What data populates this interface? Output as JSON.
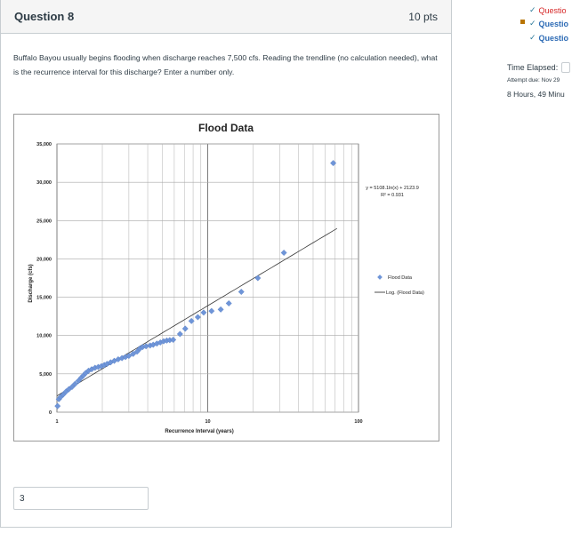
{
  "question": {
    "title": "Question 8",
    "points": "10 pts",
    "text": "Buffalo Bayou usually begins flooding when discharge reaches 7,500 cfs. Reading the trendline (no calculation needed), what is the recurrence interval for this discharge? Enter a number only.",
    "answer_value": "3"
  },
  "sidebar": {
    "items": [
      {
        "label": "Questio",
        "color": "#d62828",
        "status": "answered"
      },
      {
        "label": "Questio",
        "color": "#2d6bb5",
        "status": "flagged"
      },
      {
        "label": "Questio",
        "color": "#2d6bb5",
        "status": "answered"
      }
    ],
    "time_elapsed_label": "Time Elapsed:",
    "attempt_due": "Attempt due: Nov 29",
    "elapsed_value": "8 Hours, 49 Minu"
  },
  "chart_data": {
    "type": "scatter",
    "title": "Flood Data",
    "xlabel": "Recurrence Interval (years)",
    "ylabel": "Discharge (cfs)",
    "x_scale": "log",
    "xlim": [
      1,
      100
    ],
    "ylim": [
      0,
      35000
    ],
    "x_ticks": [
      "1",
      "10",
      "100"
    ],
    "y_ticks": [
      "0",
      "5,000",
      "10,000",
      "15,000",
      "20,000",
      "25,000",
      "30,000",
      "35,000"
    ],
    "grid": true,
    "legend_position": "right",
    "series": [
      {
        "name": "Flood Data",
        "color": "#6f95d8",
        "points": [
          [
            1.01,
            800
          ],
          [
            1.03,
            1700
          ],
          [
            1.06,
            2000
          ],
          [
            1.1,
            2300
          ],
          [
            1.15,
            2700
          ],
          [
            1.2,
            3000
          ],
          [
            1.26,
            3300
          ],
          [
            1.32,
            3700
          ],
          [
            1.39,
            4100
          ],
          [
            1.45,
            4500
          ],
          [
            1.5,
            4800
          ],
          [
            1.55,
            5100
          ],
          [
            1.62,
            5400
          ],
          [
            1.7,
            5600
          ],
          [
            1.79,
            5800
          ],
          [
            1.88,
            5900
          ],
          [
            1.97,
            6000
          ],
          [
            2.06,
            6150
          ],
          [
            2.15,
            6300
          ],
          [
            2.27,
            6500
          ],
          [
            2.4,
            6700
          ],
          [
            2.55,
            6900
          ],
          [
            2.7,
            7050
          ],
          [
            2.85,
            7200
          ],
          [
            3.0,
            7350
          ],
          [
            3.2,
            7600
          ],
          [
            3.4,
            7900
          ],
          [
            3.55,
            8300
          ],
          [
            3.7,
            8500
          ],
          [
            3.9,
            8600
          ],
          [
            4.15,
            8700
          ],
          [
            4.35,
            8800
          ],
          [
            4.6,
            8950
          ],
          [
            4.85,
            9100
          ],
          [
            5.1,
            9250
          ],
          [
            5.35,
            9350
          ],
          [
            5.6,
            9400
          ],
          [
            5.9,
            9450
          ],
          [
            6.55,
            10200
          ],
          [
            7.1,
            10900
          ],
          [
            7.8,
            11900
          ],
          [
            8.6,
            12400
          ],
          [
            9.4,
            13000
          ],
          [
            10.6,
            13200
          ],
          [
            12.2,
            13400
          ],
          [
            13.8,
            14200
          ],
          [
            16.7,
            15700
          ],
          [
            21.5,
            17500
          ],
          [
            32,
            20800
          ],
          [
            68,
            32500
          ]
        ]
      }
    ],
    "trendline": {
      "name": "Log. (Flood Data)",
      "color": "#3a3a3a",
      "equation": "y = 5108.1ln(x) + 2123.9",
      "r_squared": "R² = 0.931",
      "a": 5108.1,
      "b": 2123.9,
      "x_range": [
        1,
        72
      ]
    }
  }
}
